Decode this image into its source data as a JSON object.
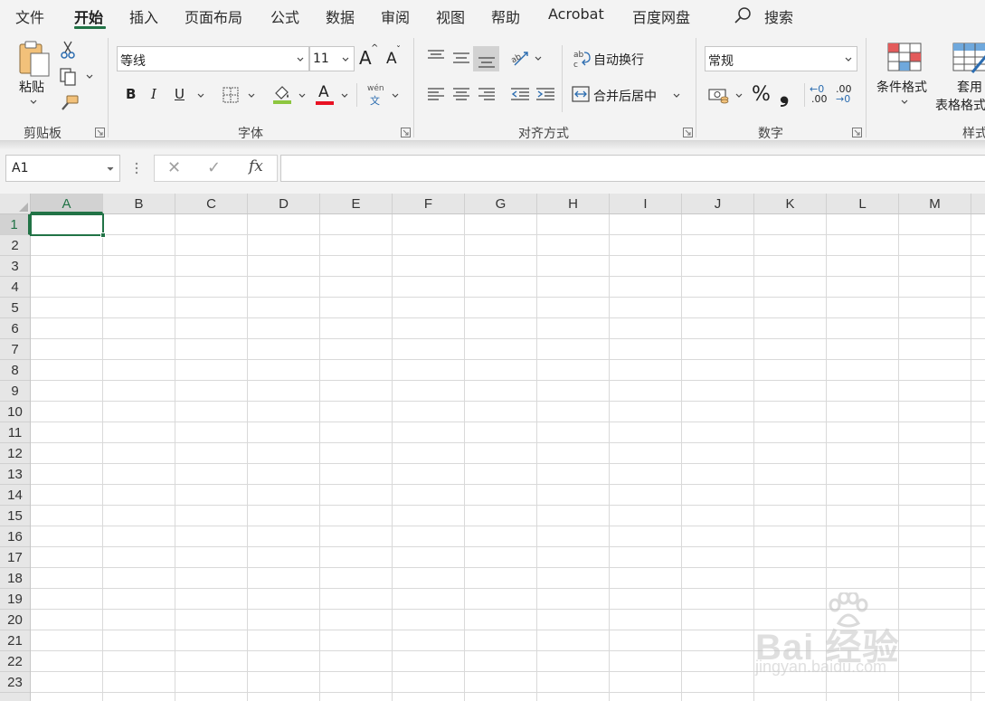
{
  "menu": {
    "tabs": [
      "文件",
      "开始",
      "插入",
      "页面布局",
      "公式",
      "数据",
      "审阅",
      "视图",
      "帮助",
      "Acrobat",
      "百度网盘"
    ],
    "active": "开始",
    "search_label": "搜索"
  },
  "ribbon": {
    "clipboard": {
      "paste_label": "粘贴",
      "group_label": "剪贴板"
    },
    "font": {
      "font_name": "等线",
      "font_size": "11",
      "bold": "B",
      "italic": "I",
      "underline": "U",
      "font_color_letter": "A",
      "grow_letter": "A",
      "shrink_letter": "A",
      "phonetic_top": "wén",
      "phonetic_bottom": "文",
      "group_label": "字体",
      "fill_color": "#8dc63f",
      "text_color": "#e81123"
    },
    "alignment": {
      "wrap_text": "自动换行",
      "merge_center": "合并后居中",
      "orient_label": "ab",
      "wrap_icon_top": "ab",
      "wrap_icon_bottom": "c",
      "group_label": "对齐方式"
    },
    "number": {
      "format": "常规",
      "percent": "%",
      "comma": "❟",
      "inc_decimal_top": "←0",
      "inc_decimal_bottom": ".00",
      "dec_decimal_top": ".00",
      "dec_decimal_bottom": "→0",
      "group_label": "数字"
    },
    "styles": {
      "conditional": "条件格式",
      "table_line1": "套用",
      "table_line2": "表格格式",
      "group_label": "样式"
    }
  },
  "formula_bar": {
    "name_box": "A1",
    "cancel_symbol": "✕",
    "enter_symbol": "✓",
    "fx_symbol": "fx",
    "formula_value": ""
  },
  "sheet": {
    "columns": [
      "A",
      "B",
      "C",
      "D",
      "E",
      "F",
      "G",
      "H",
      "I",
      "J",
      "K",
      "L",
      "M"
    ],
    "rows": [
      "1",
      "2",
      "3",
      "4",
      "5",
      "6",
      "7",
      "8",
      "9",
      "10",
      "11",
      "12",
      "13",
      "14",
      "15",
      "16",
      "17",
      "18",
      "19",
      "20",
      "21",
      "22",
      "23"
    ],
    "active_column": "A",
    "active_row": "1"
  },
  "watermark": {
    "brand": "Bai 经验",
    "url": "jingyan.baidu.com"
  },
  "colors": {
    "accent": "#217346",
    "ribbon_bg": "#f3f3f3",
    "grid_line": "#d9d9d9"
  }
}
